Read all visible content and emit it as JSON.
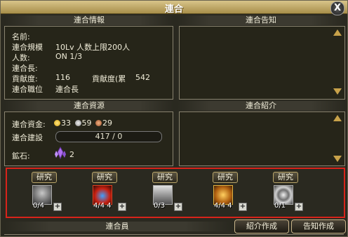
{
  "window": {
    "title": "連合",
    "close_label": "X"
  },
  "info": {
    "header": "連合情報",
    "rows": [
      {
        "label": "名前:",
        "value": ""
      },
      {
        "label": "連合規模",
        "value": "10Lv  人数上限200人"
      },
      {
        "label": "人数:",
        "value": "ON 1/3"
      },
      {
        "label": "連合長:",
        "value": ""
      },
      {
        "label": "貢献度:",
        "value": "116"
      },
      {
        "label": "連合職位",
        "value": "連合長"
      }
    ],
    "contrib_label": "貢献度(累",
    "contrib_value": "542"
  },
  "notice": {
    "header": "連合告知"
  },
  "resources": {
    "header": "連合資源",
    "funds_label": "連合資金:",
    "gold": "33",
    "silver": "59",
    "copper": "29",
    "build_label": "連合建設",
    "build_value": "417 / 0",
    "ore_label": "鉱石:",
    "ore_value": "2"
  },
  "intro": {
    "header": "連合紹介"
  },
  "research": {
    "button_label": "研究",
    "skills": [
      {
        "icon": "shadow-figure-icon",
        "level": "0/4"
      },
      {
        "icon": "red-orb-icon",
        "level": "4/4  4"
      },
      {
        "icon": "shield-icon",
        "level": "0/3"
      },
      {
        "icon": "golden-cross-icon",
        "level": "4/4  4"
      },
      {
        "icon": "whirlwind-icon",
        "level": "0/1"
      }
    ],
    "plus_label": "+"
  },
  "members": {
    "header": "連合員"
  },
  "buttons": {
    "intro_create": "紹介作成",
    "notice_create": "告知作成"
  },
  "colors": {
    "highlight_border": "#d8231a",
    "accent_gold": "#c8a24a",
    "title_bar": "#c7b170"
  }
}
